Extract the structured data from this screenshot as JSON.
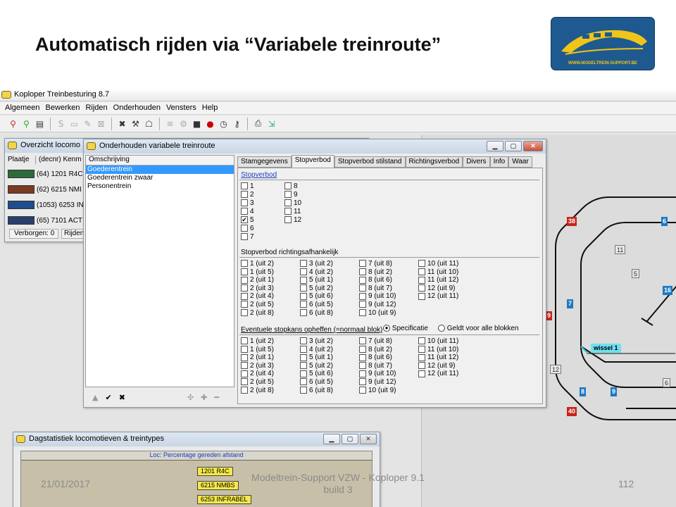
{
  "slide": {
    "title": "Automatisch rijden via “Variabele treinroute”",
    "logo_text": "WWW.MODELTREIN-SUPPORT.BE",
    "footer_date": "21/01/2017",
    "footer_center_line1": "Modeltrein-Support VZW - Koploper 9.1",
    "footer_center_line2": "build 3",
    "footer_page": "112"
  },
  "app": {
    "title": "Koploper Treinbesturing 8.7",
    "menu": [
      "Algemeen",
      "Bewerken",
      "Rijden",
      "Onderhouden",
      "Vensters",
      "Help"
    ],
    "toolbar_icons": [
      "signal-red-icon",
      "signal-green-icon",
      "keyboard-icon",
      "s-icon",
      "screen-icon",
      "edit-icon",
      "cross-box-icon",
      "train-cross-icon",
      "train-icon",
      "ghost-icon",
      "wind-icon",
      "gear-icon",
      "loco-icon",
      "red-dot-icon",
      "clock-icon",
      "tools-icon",
      "printer-icon",
      "export-icon"
    ]
  },
  "overview": {
    "title": "Overzicht locomo",
    "headers": [
      "Plaatje",
      "(decnr) Kenm"
    ],
    "rows": [
      {
        "label": "(64) 1201 R4C",
        "color": "#2e6b3a"
      },
      {
        "label": "(62) 6215 NMI",
        "color": "#7a3b20"
      },
      {
        "label": "(1053) 6253 IN",
        "color": "#1f4e8a"
      },
      {
        "label": "(65) 7101 ACT",
        "color": "#2b3f6b"
      }
    ],
    "footer_left": "Verborgen: 0",
    "footer_right": "Rijden"
  },
  "dialog": {
    "title": "Onderhouden variabele treinroute",
    "list_header": "Omschrijving",
    "list_items": [
      "Goederentrein",
      "Goederentrein zwaar",
      "Personentrein"
    ],
    "selected_index": 0,
    "tabs": [
      "Stamgegevens",
      "Stopverbod",
      "Stopverbod stilstand",
      "Richtingsverbod",
      "Divers",
      "Info",
      "Waar"
    ],
    "active_tab": 1,
    "section1_label": "Stopverbod",
    "section1_col1": [
      {
        "l": "1",
        "c": false
      },
      {
        "l": "2",
        "c": false
      },
      {
        "l": "3",
        "c": false
      },
      {
        "l": "4",
        "c": false
      },
      {
        "l": "5",
        "c": true
      },
      {
        "l": "6",
        "c": false
      },
      {
        "l": "7",
        "c": false
      }
    ],
    "section1_col2": [
      {
        "l": "8",
        "c": false
      },
      {
        "l": "9",
        "c": false
      },
      {
        "l": "10",
        "c": false
      },
      {
        "l": "11",
        "c": false
      },
      {
        "l": "12",
        "c": false
      }
    ],
    "section2_label": "Stopverbod richtingsafhankelijk",
    "grid": [
      [
        "1 (uit 2)",
        "1 (uit 5)",
        "2 (uit 1)",
        "2 (uit 3)",
        "2 (uit 4)",
        "2 (uit 5)",
        "2 (uit 8)"
      ],
      [
        "3 (uit 2)",
        "4 (uit 2)",
        "5 (uit 1)",
        "5 (uit 2)",
        "5 (uit 6)",
        "6 (uit 5)",
        "6 (uit 8)"
      ],
      [
        "7 (uit 8)",
        "8 (uit 2)",
        "8 (uit 6)",
        "8 (uit 7)",
        "9 (uit 10)",
        "9 (uit 12)",
        "10 (uit 9)"
      ],
      [
        "10 (uit 11)",
        "11 (uit 10)",
        "11 (uit 12)",
        "12 (uit 9)",
        "12 (uit 11)"
      ]
    ],
    "section3_label": "Eventuele stopkans opheffen (=normaal blok)",
    "radio1": "Specificatie",
    "radio2": "Geldt voor alle blokken",
    "bottom_icons": [
      "up-arrow-icon",
      "check-icon",
      "cross-icon",
      "puzzle-icon",
      "plus-icon",
      "minus-icon"
    ]
  },
  "stats": {
    "title": "Dagstatistiek locomotieven & treintypes",
    "header": "Loc: Percentage gereden afstand",
    "bars": [
      "1201 R4C",
      "6215 NMBS",
      "6253 INFRABEL"
    ]
  },
  "track": {
    "signs": [
      {
        "t": "11",
        "k": "grey"
      },
      {
        "t": "5",
        "k": "grey"
      },
      {
        "t": "38",
        "k": "red"
      },
      {
        "t": "6",
        "k": "blue"
      },
      {
        "t": "16",
        "k": "blue"
      },
      {
        "t": "7",
        "k": "blue"
      },
      {
        "t": "9",
        "k": "red"
      },
      {
        "t": "12",
        "k": "grey"
      },
      {
        "t": "8",
        "k": "blue"
      },
      {
        "t": "9",
        "k": "blue"
      },
      {
        "t": "6",
        "k": "grey"
      },
      {
        "t": "40",
        "k": "red"
      }
    ],
    "switch_label": "wissel 1"
  }
}
